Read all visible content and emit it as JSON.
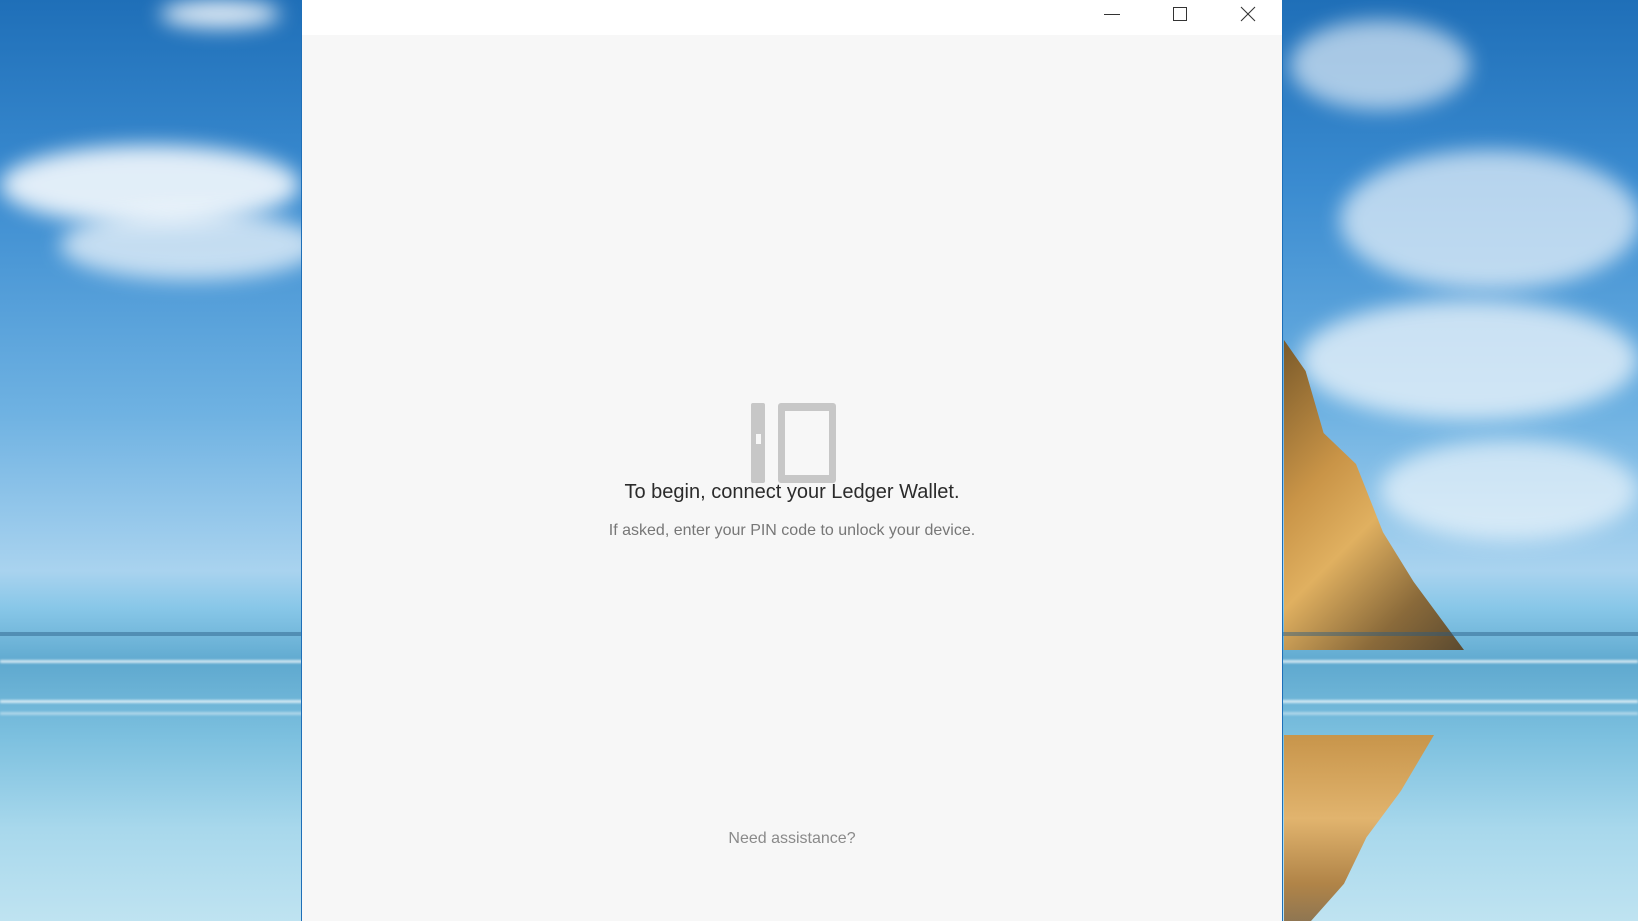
{
  "desktop": {
    "wallpaper": "beach-wallpaper"
  },
  "window": {
    "controls": {
      "minimize_icon": "minimize-icon",
      "maximize_icon": "maximize-icon",
      "close_icon": "close-icon"
    }
  },
  "main": {
    "icon": "ledger-device-icon",
    "title": "To begin, connect your Ledger Wallet.",
    "subtitle": "If asked, enter your PIN code to unlock your device.",
    "help_link": "Need assistance?"
  },
  "colors": {
    "window_border": "#1e6fb8",
    "background": "#f7f7f7",
    "title_text": "#2b2b2b",
    "subtitle_text": "#777777",
    "icon": "#c7c7c7"
  }
}
